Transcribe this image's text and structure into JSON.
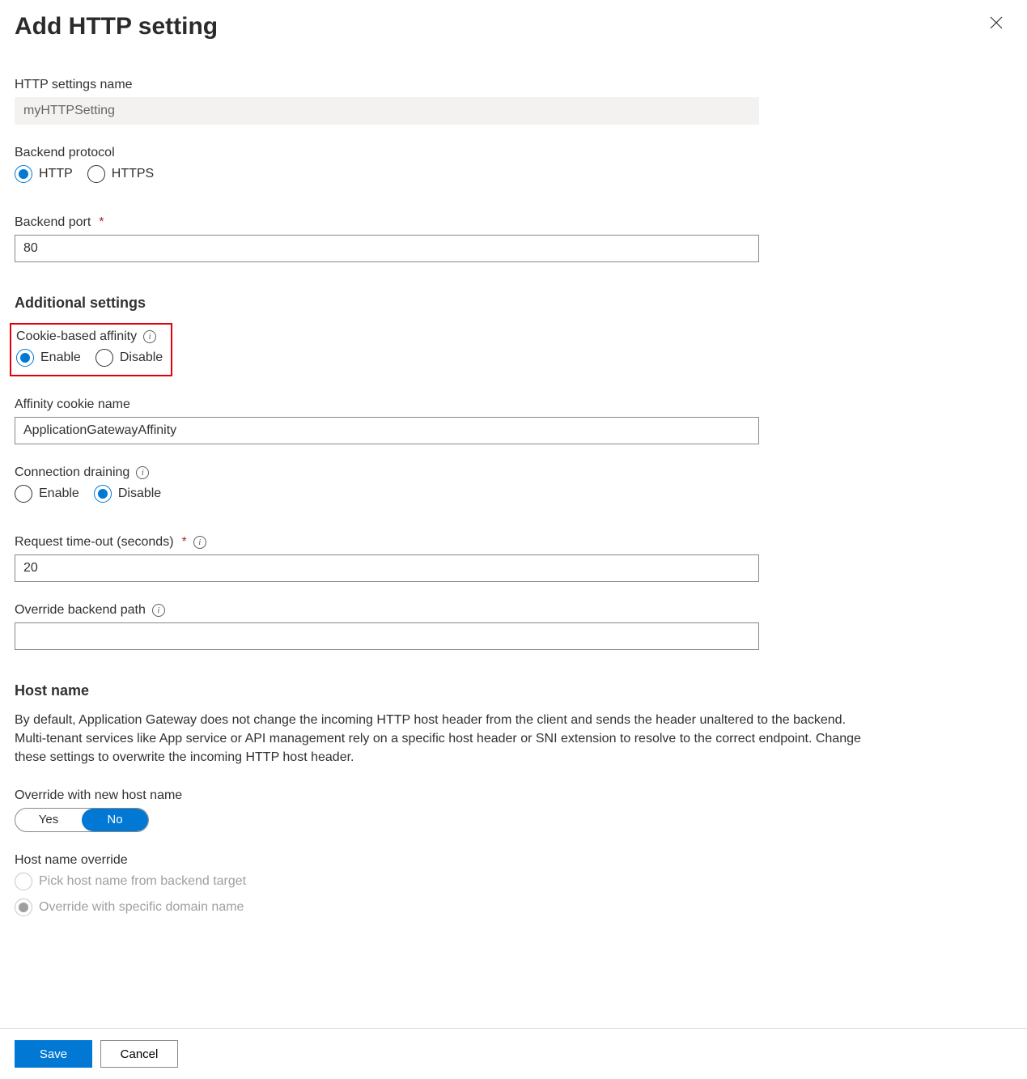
{
  "header": {
    "title": "Add HTTP setting"
  },
  "form": {
    "http_settings_name": {
      "label": "HTTP settings name",
      "value": "myHTTPSetting"
    },
    "backend_protocol": {
      "label": "Backend protocol",
      "http": "HTTP",
      "https": "HTTPS",
      "selected": "http"
    },
    "backend_port": {
      "label": "Backend port",
      "value": "80"
    },
    "additional_heading": "Additional settings",
    "cookie_affinity": {
      "label": "Cookie-based affinity",
      "enable": "Enable",
      "disable": "Disable",
      "selected": "enable"
    },
    "affinity_cookie_name": {
      "label": "Affinity cookie name",
      "value": "ApplicationGatewayAffinity"
    },
    "connection_draining": {
      "label": "Connection draining",
      "enable": "Enable",
      "disable": "Disable",
      "selected": "disable"
    },
    "request_timeout": {
      "label": "Request time-out (seconds)",
      "value": "20"
    },
    "override_backend_path": {
      "label": "Override backend path",
      "value": ""
    },
    "hostname_heading": "Host name",
    "hostname_desc": "By default, Application Gateway does not change the incoming HTTP host header from the client and sends the header unaltered to the backend. Multi-tenant services like App service or API management rely on a specific host header or SNI extension to resolve to the correct endpoint. Change these settings to overwrite the incoming HTTP host header.",
    "override_new_host": {
      "label": "Override with new host name",
      "yes": "Yes",
      "no": "No",
      "selected": "no"
    },
    "host_name_override": {
      "label": "Host name override",
      "pick_from_backend": "Pick host name from backend target",
      "override_specific": "Override with specific domain name"
    }
  },
  "footer": {
    "save": "Save",
    "cancel": "Cancel"
  }
}
